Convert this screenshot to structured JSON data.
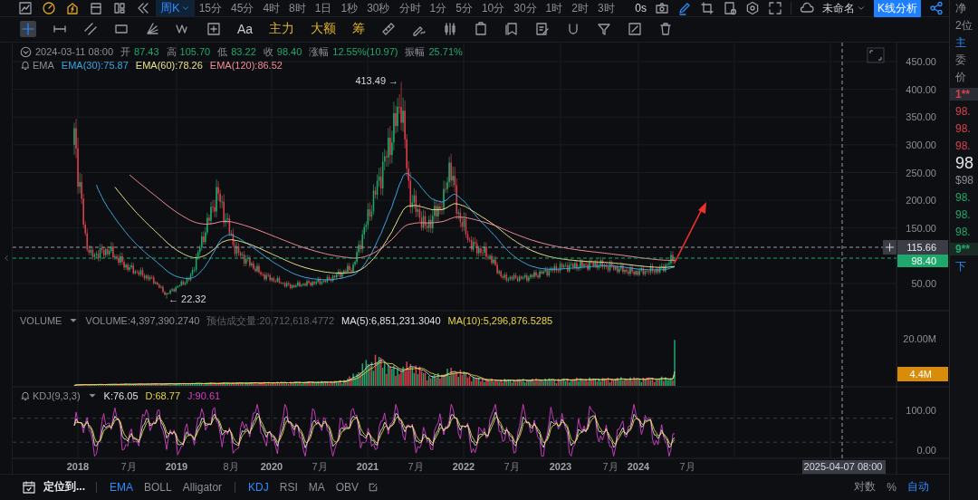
{
  "top_bar": {
    "intervals": [
      {
        "label": "周K",
        "selected": true,
        "kind": "dropdown"
      },
      {
        "label": "15分",
        "selected": false,
        "kind": "plain"
      },
      {
        "label": "45分",
        "selected": false,
        "kind": "plain"
      },
      {
        "label": "4时",
        "selected": false,
        "kind": "plain"
      },
      {
        "label": "8时",
        "selected": false,
        "kind": "plain"
      },
      {
        "label": "1日",
        "selected": false,
        "kind": "plain"
      },
      {
        "label": "1秒",
        "selected": false,
        "kind": "plain"
      },
      {
        "label": "30秒",
        "selected": false,
        "kind": "plain"
      },
      {
        "label": "分时",
        "selected": false,
        "kind": "plain"
      },
      {
        "label": "1分",
        "selected": false,
        "kind": "plain"
      },
      {
        "label": "5分",
        "selected": false,
        "kind": "plain"
      },
      {
        "label": "10分",
        "selected": false,
        "kind": "plain"
      },
      {
        "label": "30分",
        "selected": false,
        "kind": "plain"
      },
      {
        "label": "1时",
        "selected": false,
        "kind": "plain"
      },
      {
        "label": "2时",
        "selected": false,
        "kind": "plain"
      },
      {
        "label": "3时",
        "selected": false,
        "kind": "plain"
      }
    ],
    "timer": "0s",
    "layout_name": "未命名",
    "analysis_button": "K线分析"
  },
  "drawing_toolbar": {
    "crosshair_selected": true,
    "text_tool": "Aa",
    "feature_tools": [
      "主力",
      "大额",
      "筹"
    ]
  },
  "legend": {
    "datetime": "2024-03-11 08:00",
    "fields": [
      {
        "label": "开",
        "value": "87.43"
      },
      {
        "label": "高",
        "value": "105.70"
      },
      {
        "label": "低",
        "value": "83.22"
      },
      {
        "label": "收",
        "value": "98.40"
      },
      {
        "label": "涨幅",
        "value": "12.55%(10.97)"
      },
      {
        "label": "振幅",
        "value": "25.71%"
      }
    ],
    "indicator": "EMA",
    "emas": [
      {
        "text": "EMA(30):75.87",
        "color": "#3aa6e0"
      },
      {
        "text": "EMA(60):78.26",
        "color": "#e6e08c"
      },
      {
        "text": "EMA(120):86.52",
        "color": "#f08c96"
      }
    ]
  },
  "price_chart": {
    "y_axis_labels": [
      "450.00",
      "400.00",
      "350.00",
      "300.00",
      "250.00",
      "200.00",
      "150.00",
      "50.00"
    ],
    "high_label": "413.49 →",
    "low_label": "← 22.32",
    "crosshair_price": "115.66",
    "last_price": "98.40"
  },
  "volume_pane": {
    "title": "VOLUME",
    "volume": "VOLUME:4,397,390.2740",
    "estimate": "预估成交量:20,712,618.4772",
    "ma5": "MA(5):6,851,231.3040",
    "ma10": "MA(10):5,296,876.5285",
    "axis_label": "20.00M",
    "current_tag": "4.4M"
  },
  "kdj_pane": {
    "title": "KDJ(9,3,3)",
    "k": "K:76.05",
    "d": "D:68.77",
    "j": "J:90.61",
    "axis_labels": [
      "100.00",
      "0.00"
    ]
  },
  "x_axis": {
    "labels": [
      {
        "text": "2018",
        "kind": "year"
      },
      {
        "text": "7月",
        "kind": "month"
      },
      {
        "text": "2019",
        "kind": "year"
      },
      {
        "text": "8月",
        "kind": "month"
      },
      {
        "text": "2020",
        "kind": "year"
      },
      {
        "text": "7月",
        "kind": "month"
      },
      {
        "text": "2021",
        "kind": "year"
      },
      {
        "text": "7月",
        "kind": "month"
      },
      {
        "text": "2022",
        "kind": "year"
      },
      {
        "text": "7月",
        "kind": "month"
      },
      {
        "text": "2023",
        "kind": "year"
      },
      {
        "text": "7月",
        "kind": "month"
      },
      {
        "text": "2024",
        "kind": "year"
      },
      {
        "text": "7月",
        "kind": "month"
      }
    ],
    "crosshair_time": "2025-04-07 08:00"
  },
  "bottom_bar": {
    "locate": "定位到...",
    "main_indicators": [
      {
        "label": "EMA",
        "selected": true
      },
      {
        "label": "BOLL",
        "selected": false
      },
      {
        "label": "Alligator",
        "selected": false
      }
    ],
    "sub_indicators": [
      {
        "label": "KDJ",
        "selected": true
      },
      {
        "label": "RSI",
        "selected": false
      },
      {
        "label": "MA",
        "selected": false
      },
      {
        "label": "OBV",
        "selected": false
      }
    ],
    "scale_options": [
      {
        "label": "对数",
        "selected": false
      },
      {
        "label": "%",
        "selected": false
      },
      {
        "label": "自动",
        "selected": true
      }
    ]
  },
  "side_panel": {
    "items": [
      {
        "text": "净",
        "kind": "label"
      },
      {
        "text": "2位",
        "kind": "label"
      },
      {
        "text": "主",
        "kind": "tab"
      },
      {
        "text": "委",
        "kind": "label"
      },
      {
        "text": "价",
        "kind": "label"
      },
      {
        "text": "1**",
        "kind": "ask-head"
      },
      {
        "text": "98.",
        "kind": "ask"
      },
      {
        "text": "98.",
        "kind": "ask"
      },
      {
        "text": "98.",
        "kind": "ask"
      },
      {
        "text": "98",
        "kind": "price"
      },
      {
        "text": "$98",
        "kind": "sub"
      },
      {
        "text": "98.",
        "kind": "bid"
      },
      {
        "text": "98.",
        "kind": "bid"
      },
      {
        "text": "98.",
        "kind": "bid"
      },
      {
        "text": "9**",
        "kind": "bid-head"
      },
      {
        "text": "下",
        "kind": "tab"
      }
    ]
  }
}
